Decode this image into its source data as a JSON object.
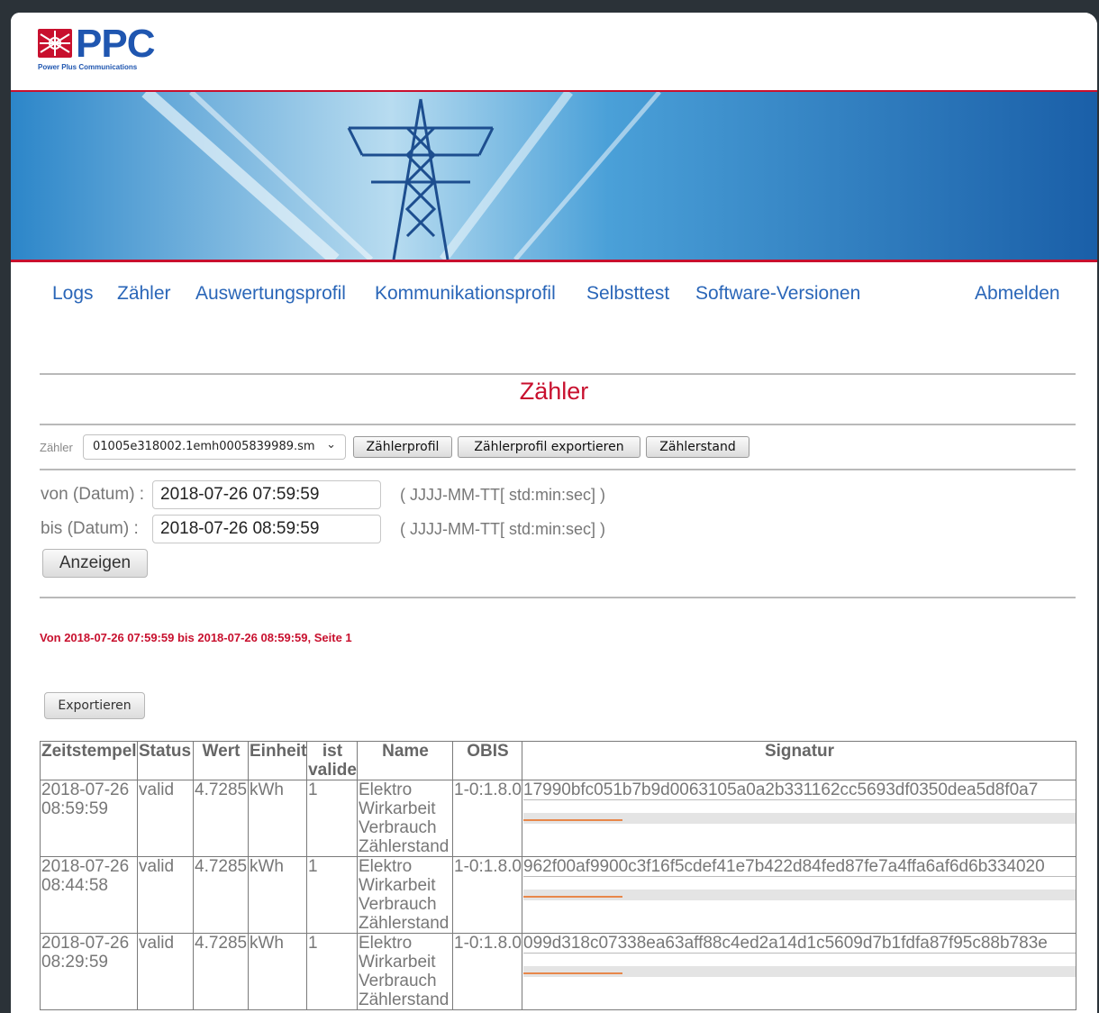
{
  "logo": {
    "name": "PPC",
    "subtitle": "Power Plus Communications"
  },
  "nav": {
    "logs": "Logs",
    "meter": "Zähler",
    "evaluation_profile": "Auswertungsprofil",
    "communication_profile": "Kommunikationsprofil",
    "self_test": "Selbsttest",
    "software_versions": "Software-Versionen",
    "logout": "Abmelden"
  },
  "page_title": "Zähler",
  "meter": {
    "label": "Zähler",
    "selected": "01005e318002.1emh0005839989.sm",
    "profile_button": "Zählerprofil",
    "export_profile_button": "Zählerprofil exportieren",
    "reading_button": "Zählerstand"
  },
  "form": {
    "from_label": "von (Datum) :",
    "from_value": "2018-07-26 07:59:59",
    "to_label": "bis (Datum) :",
    "to_value": "2018-07-26 08:59:59",
    "format_hint": "( JJJJ-MM-TT[ std:min:sec] )",
    "show_button": "Anzeigen"
  },
  "range_message": "Von 2018-07-26 07:59:59 bis 2018-07-26 08:59:59, Seite 1",
  "export_button": "Exportieren",
  "table": {
    "headers": {
      "timestamp": "Zeitstempel",
      "status": "Status",
      "value": "Wert",
      "unit": "Einheit",
      "is_valid": "ist valide",
      "name": "Name",
      "obis": "OBIS",
      "signature": "Signatur"
    },
    "rows": [
      {
        "timestamp": "2018-07-26 08:59:59",
        "status": "valid",
        "value": "4.7285",
        "unit": "kWh",
        "is_valid": "1",
        "name": "Elektro Wirkarbeit Verbrauch Zählerstand",
        "obis": "1-0:1.8.0",
        "signature": "17990bfc051b7b9d0063105a0a2b331162cc5693df0350dea5d8f0a7",
        "progress": 0.18
      },
      {
        "timestamp": "2018-07-26 08:44:58",
        "status": "valid",
        "value": "4.7285",
        "unit": "kWh",
        "is_valid": "1",
        "name": "Elektro Wirkarbeit Verbrauch Zählerstand",
        "obis": "1-0:1.8.0",
        "signature": "962f00af9900c3f16f5cdef41e7b422d84fed87fe7a4ffa6af6d6b334020",
        "progress": 0.18
      },
      {
        "timestamp": "2018-07-26 08:29:59",
        "status": "valid",
        "value": "4.7285",
        "unit": "kWh",
        "is_valid": "1",
        "name": "Elektro Wirkarbeit Verbrauch Zählerstand",
        "obis": "1-0:1.8.0",
        "signature": "099d318c07338ea63aff88c4ed2a14d1c5609d7b1fdfa87f95c88b783e",
        "progress": 0.18
      }
    ]
  }
}
